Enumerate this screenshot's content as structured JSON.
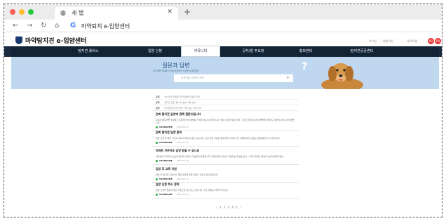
{
  "browser": {
    "tab_title": "새 탭",
    "tab_favicon": "globe-icon",
    "tab_close": "✕",
    "new_tab": "+",
    "url_text": "마약퇴치 e-입양센터"
  },
  "site": {
    "logo_text": "마약탐지견 e-입양센터",
    "util_links": [
      "로그인",
      "회원가입",
      "사이트맵"
    ],
    "lang_badges": [
      "KR",
      "EN"
    ]
  },
  "gnb": {
    "items": [
      "탐지견 플러스",
      "입양 신청",
      "커뮤니티",
      "공지/알 주요정",
      "홍보센터",
      "탐지견공공센터"
    ],
    "active_index": 2
  },
  "hero": {
    "title": "질문과 답변",
    "subtitle": "탐지견을 입양하기 위해 궁금하신 사항을 남겨주세요",
    "search_placeholder": "검색어를 입력해주세요",
    "search_icon": "search-icon"
  },
  "notices": [
    {
      "tag": "공지",
      "text": "2023년 마약탐지견 입양센터 이용 안내"
    },
    {
      "tag": "공지",
      "text": "탐지견 입양 절차 및 필요 서류 안내"
    },
    {
      "tag": "공지",
      "text": "마약탐지견 입양 관련 자주 묻는 질문 정리"
    }
  ],
  "faqs": [
    {
      "title": "은퇴 탐지견 입양에 관해 질문드립니다",
      "body": "은퇴한 탐지견을 입양하고 싶은데 어떤 절차를 거쳐야 하는지 궁금합니다. 입양 조건과 필요 서류, 그리고 입양 후 관리 방법에 대해서도 알려주시면 감사하겠습니다.",
      "user": "USERNAME",
      "date": "2023.06.01"
    },
    {
      "title": "은퇴 탐지견 입양 문의",
      "body": "입양 신청 후 대기 기간이 얼마나 되는지 알고 싶습니다. 또한 입양 가능한 탐지견의 나이와 건강 상태에 대한 정보도 함께 확인할 수 있을까요?",
      "user": "USERNAME",
      "date": "2023.05.28"
    },
    {
      "title": "아파트 거주자도 입양 받을 수 있나요",
      "body": "아파트에 거주하고 있는데 탐지견 입양이 가능한지 궁금합니다. 대형견이라 공간이 걱정되는데 입양 심사 시 주거 환경도 확인하시는지 알려주세요.",
      "user": "USERNAME",
      "date": "2023.05.20"
    },
    {
      "title": "입양 후 교육 지원",
      "body": "입양 후 탐지견 교육이나 적응 훈련에 대한 지원이 있는지 문의드립니다.",
      "user": "USERNAME",
      "date": "2023.05.15"
    },
    {
      "title": "입양 신청 취소 문의",
      "body": "입양 신청을 했는데 개인 사정으로 취소하고 싶습니다. 취소 절차는 어떻게 되나요?",
      "user": "USERNAME",
      "date": "2023.05.10"
    }
  ],
  "pagination": "‹ 1 2 3 4 5 ›"
}
